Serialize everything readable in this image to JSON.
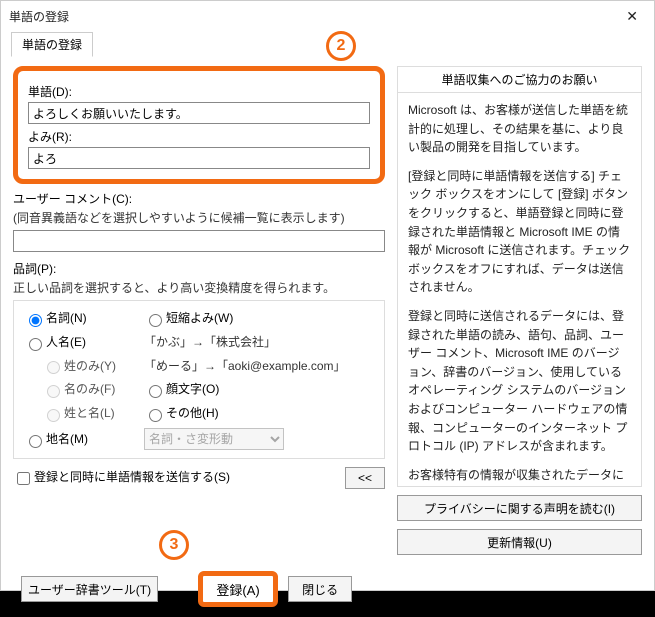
{
  "window": {
    "title": "単語の登録"
  },
  "tab": "単語の登録",
  "fields": {
    "tango_label": "単語(D):",
    "tango_value": "よろしくお願いいたします。",
    "yomi_label": "よみ(R):",
    "yomi_value": "よろ",
    "comment_label": "ユーザー コメント(C):",
    "comment_hint": "(同音異義語などを選択しやすいように候補一覧に表示します)",
    "comment_value": ""
  },
  "pos": {
    "label": "品詞(P):",
    "hint": "正しい品詞を選択すると、より高い変換精度を得られます。",
    "meishi": "名詞(N)",
    "tanshuku": "短縮よみ(W)",
    "jinmei": "人名(E)",
    "sei": "姓のみ(Y)",
    "mei": "名のみ(F)",
    "seimei": "姓と名(L)",
    "kaomoji": "顔文字(O)",
    "sonota": "その他(H)",
    "chimei": "地名(M)",
    "example1": "「かぶ」→「株式会社」",
    "example2": "「めーる」→「aoki@example.com」",
    "combo": "名詞・さ変形動"
  },
  "send": {
    "checkbox": "登録と同時に単語情報を送信する(S)",
    "toggle": "<<"
  },
  "buttons": {
    "dict_tool": "ユーザー辞書ツール(T)",
    "register": "登録(A)",
    "close": "閉じる"
  },
  "side": {
    "title": "単語収集へのご協力のお願い",
    "p1": "Microsoft は、お客様が送信した単語を統計的に処理し、その結果を基に、より良い製品の開発を目指しています。",
    "p2": "[登録と同時に単語情報を送信する] チェック ボックスをオンにして [登録] ボタンをクリックすると、単語登録と同時に登録された単語情報と Microsoft IME の情報が Microsoft に送信されます。チェック ボックスをオフにすれば、データは送信されません。",
    "p3": "登録と同時に送信されるデータには、登録された単語の読み、語句、品詞、ユーザー コメント、Microsoft IME のバージョン、辞書のバージョン、使用しているオペレーティング システムのバージョンおよびコンピューター ハードウェアの情報、コンピューターのインターネット プロトコル (IP) アドレスが含まれます。",
    "p4": "お客様特有の情報が収集されたデータに含まれることがあります。このような情報が存在する場合でも、Microsoft では、お客様を特定する",
    "privacy": "プライバシーに関する声明を読む(I)",
    "update": "更新情報(U)"
  },
  "badges": {
    "two": "2",
    "three": "3"
  }
}
